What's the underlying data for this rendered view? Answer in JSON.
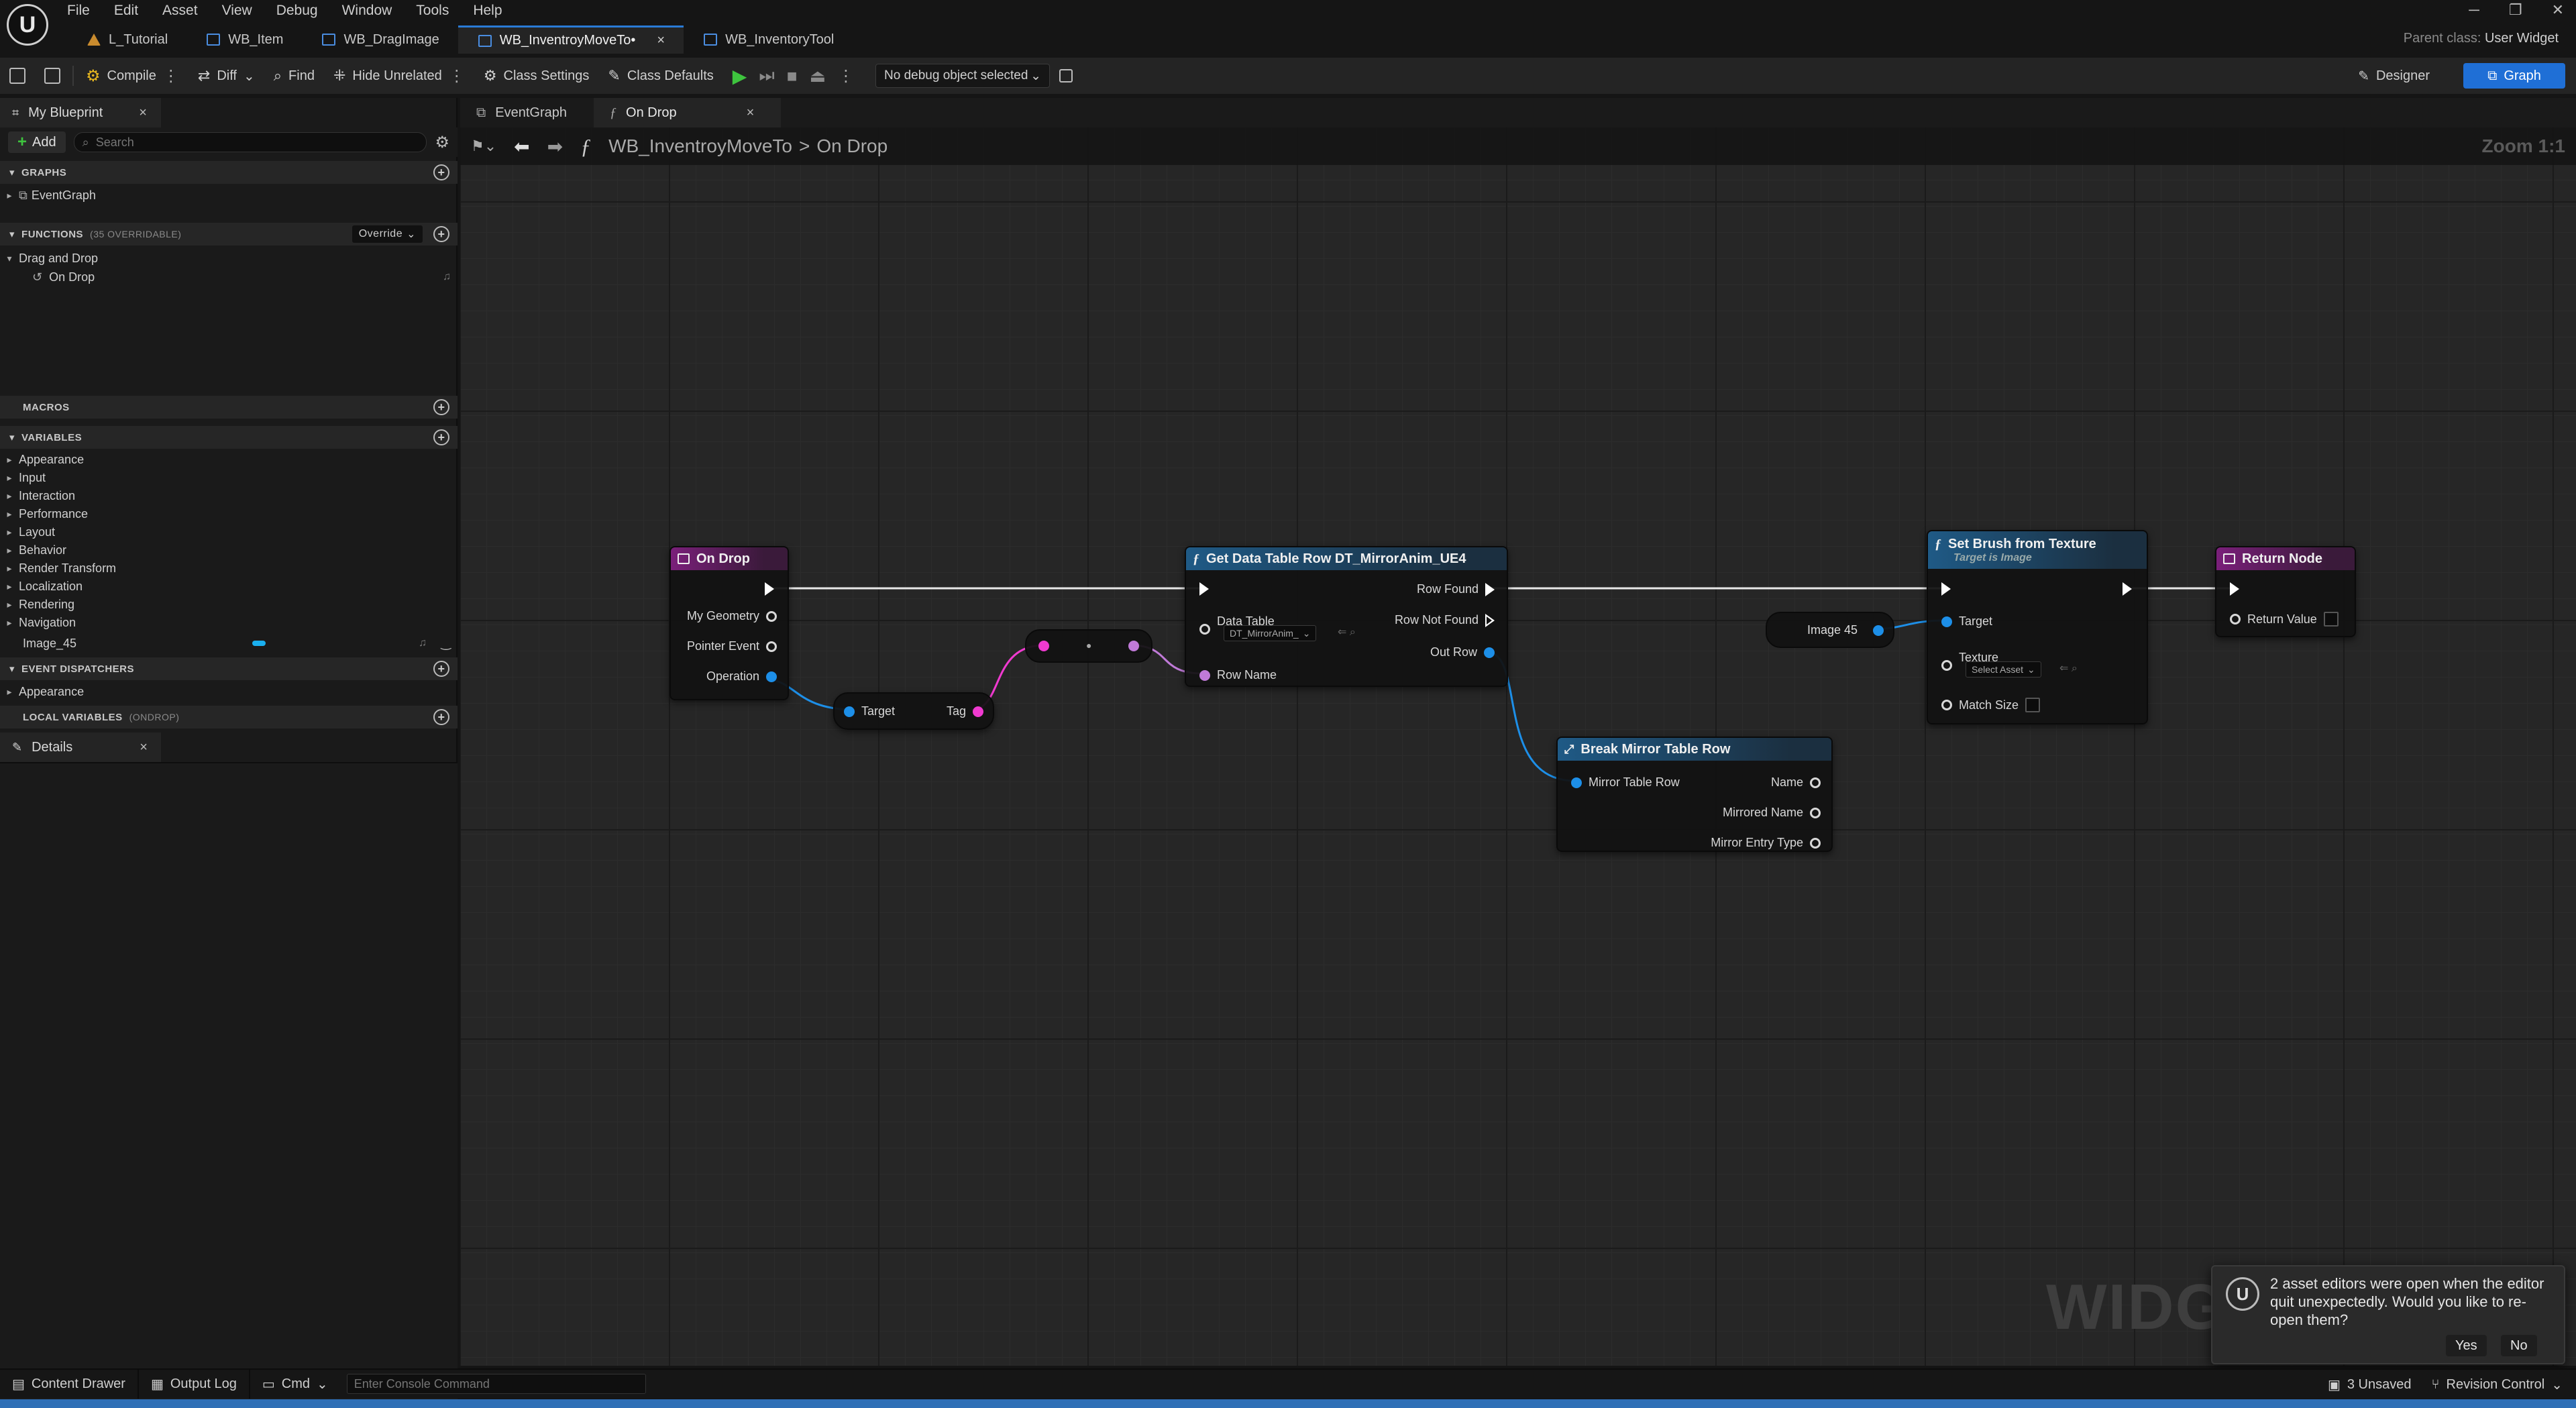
{
  "menu": [
    "File",
    "Edit",
    "Asset",
    "View",
    "Debug",
    "Window",
    "Tools",
    "Help"
  ],
  "logo_text": "U",
  "window_controls": {
    "minimize": "─",
    "restore": "❐",
    "close": "✕"
  },
  "asset_tabs": [
    {
      "label": "L_Tutorial",
      "kind": "level"
    },
    {
      "label": "WB_Item",
      "kind": "widget"
    },
    {
      "label": "WB_DragImage",
      "kind": "widget"
    },
    {
      "label": "WB_InventroyMoveTo•",
      "kind": "widget",
      "active": true,
      "close": "×"
    },
    {
      "label": "WB_InventoryTool",
      "kind": "widget"
    }
  ],
  "parent_class": {
    "label": "Parent class:",
    "value": "User Widget"
  },
  "toolbar": {
    "compile": "Compile",
    "diff": "Diff",
    "find": "Find",
    "hide_unrelated": "Hide Unrelated",
    "class_settings": "Class Settings",
    "class_defaults": "Class Defaults",
    "debug_object": "No debug object selected",
    "designer": "Designer",
    "graph": "Graph"
  },
  "my_blueprint": {
    "tab_label": "My Blueprint",
    "add_label": "Add",
    "search_placeholder": "Search",
    "sections": {
      "graphs": "GRAPHS",
      "functions": "FUNCTIONS",
      "functions_count": "(35 OVERRIDABLE)",
      "override": "Override",
      "macros": "MACROS",
      "variables": "VARIABLES",
      "event_dispatchers": "EVENT DISPATCHERS",
      "local_variables": "LOCAL VARIABLES",
      "local_variables_scope": "(ONDROP)"
    },
    "graphs": [
      "EventGraph"
    ],
    "function_category": "Drag and Drop",
    "functions": [
      "On Drop"
    ],
    "variable_categories": [
      "Appearance",
      "Input",
      "Interaction",
      "Performance",
      "Layout",
      "Behavior",
      "Render Transform",
      "Localization",
      "Rendering",
      "Navigation"
    ],
    "variables": [
      {
        "name": "Image_45",
        "color": "#1ab0f0"
      }
    ],
    "dispatcher_categories": [
      "Appearance"
    ]
  },
  "details": {
    "tab_label": "Details"
  },
  "graph_tabs": [
    {
      "label": "EventGraph"
    },
    {
      "label": "On Drop",
      "active": true
    }
  ],
  "breadcrumb": {
    "root": "WB_InventroyMoveTo",
    "separator": ">",
    "current": "On Drop"
  },
  "zoom": "Zoom 1:1",
  "watermark": "WIDGET",
  "nodes": {
    "on_drop": {
      "title": "On Drop",
      "pins": [
        "My Geometry",
        "Pointer Event",
        "Operation"
      ]
    },
    "get_tag": {
      "target": "Target",
      "tag": "Tag"
    },
    "get_data_table_row": {
      "title": "Get Data Table Row DT_MirrorAnim_UE4",
      "data_table_label": "Data Table",
      "data_table_value": "DT_MirrorAnim_",
      "row_name": "Row Name",
      "row_found": "Row Found",
      "row_not_found": "Row Not Found",
      "out_row": "Out Row"
    },
    "image_var": {
      "label": "Image 45"
    },
    "set_brush": {
      "title": "Set Brush from Texture",
      "subtitle": "Target is Image",
      "target": "Target",
      "texture": "Texture",
      "texture_value": "Select Asset",
      "match_size": "Match Size"
    },
    "return_node": {
      "title": "Return Node",
      "return_value": "Return Value"
    },
    "break_row": {
      "title": "Break Mirror Table Row",
      "input": "Mirror Table Row",
      "outputs": [
        "Name",
        "Mirrored Name",
        "Mirror Entry Type"
      ]
    }
  },
  "notification": {
    "text": "2 asset editors were open when the editor quit unexpectedly. Would you like to re-open them?",
    "yes": "Yes",
    "no": "No"
  },
  "statusbar": {
    "content_drawer": "Content Drawer",
    "output_log": "Output Log",
    "cmd": "Cmd",
    "console_placeholder": "Enter Console Command",
    "unsaved": "3 Unsaved",
    "revision_control": "Revision Control"
  }
}
